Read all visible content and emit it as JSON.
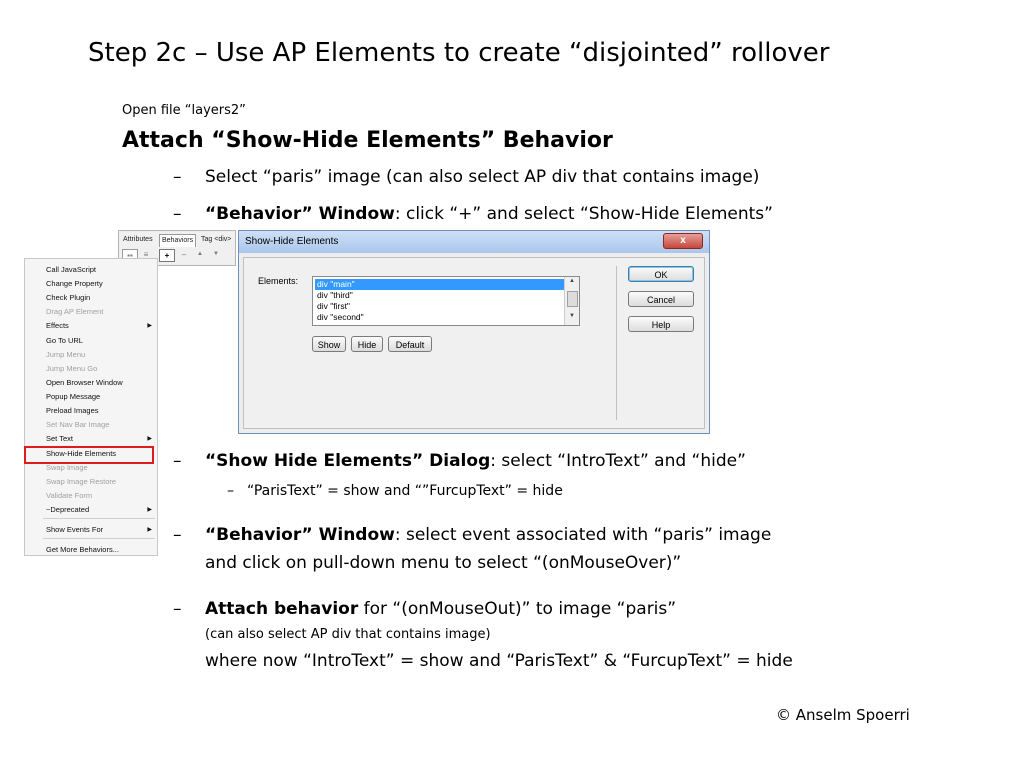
{
  "slide": {
    "title": "Step 2c – Use AP Elements to create “disjointed” rollover",
    "open_file": "Open file “layers2”",
    "heading": "Attach “Show-Hide Elements” Behavior",
    "dash": "–",
    "bullet1": "Select “paris” image (can also select AP div that contains image)",
    "bullet2_bold": "“Behavior” Window",
    "bullet2_rest": ": click “+” and select “Show-Hide Elements”",
    "bullet3_bold": "“Show Hide Elements” Dialog",
    "bullet3_rest": ": select “IntroText” and “hide”",
    "sub1": "“ParisText” = show and “”FurcupText” = hide",
    "bullet4_bold": "“Behavior” Window",
    "bullet4_rest": ": select event associated with “paris” image",
    "bullet4_line2": "and click on pull-down menu to select “(onMouseOver)”",
    "bullet5_bold": "Attach behavior",
    "bullet5_rest": " for “(onMouseOut)” to image “paris”",
    "bullet5_line2": "(can also select AP div that contains image)",
    "bullet5_line3": "where now “IntroText” = show and “ParisText” & “FurcupText” = hide",
    "credit": "© Anselm Spoerri"
  },
  "panel": {
    "tabs": [
      "Attributes",
      "Behaviors",
      "Tag <div>"
    ],
    "active_tab": "Behaviors",
    "plus_label": "+",
    "minus_label": "–",
    "up_label": "▲",
    "down_label": "▼"
  },
  "menu": {
    "items": [
      {
        "label": "Call JavaScript",
        "enabled": true,
        "submenu": false
      },
      {
        "label": "Change Property",
        "enabled": true,
        "submenu": false
      },
      {
        "label": "Check Plugin",
        "enabled": true,
        "submenu": false
      },
      {
        "label": "Drag AP Element",
        "enabled": false,
        "submenu": false
      },
      {
        "label": "Effects",
        "enabled": true,
        "submenu": true
      },
      {
        "label": "Go To URL",
        "enabled": true,
        "submenu": false
      },
      {
        "label": "Jump Menu",
        "enabled": false,
        "submenu": false
      },
      {
        "label": "Jump Menu Go",
        "enabled": false,
        "submenu": false
      },
      {
        "label": "Open Browser Window",
        "enabled": true,
        "submenu": false
      },
      {
        "label": "Popup Message",
        "enabled": true,
        "submenu": false
      },
      {
        "label": "Preload Images",
        "enabled": true,
        "submenu": false
      },
      {
        "label": "Set Nav Bar Image",
        "enabled": false,
        "submenu": false
      },
      {
        "label": "Set Text",
        "enabled": true,
        "submenu": true
      },
      {
        "label": "Show-Hide Elements",
        "enabled": true,
        "submenu": false,
        "highlighted": true
      },
      {
        "label": "Swap Image",
        "enabled": false,
        "submenu": false
      },
      {
        "label": "Swap Image Restore",
        "enabled": false,
        "submenu": false
      },
      {
        "label": "Validate Form",
        "enabled": false,
        "submenu": false
      },
      {
        "label": "~Deprecated",
        "enabled": true,
        "submenu": true
      },
      {
        "label": "Show Events For",
        "enabled": true,
        "submenu": true
      },
      {
        "label": "Get More Behaviors...",
        "enabled": true,
        "submenu": false
      }
    ],
    "submenu_arrow": "▶"
  },
  "dialog": {
    "title": "Show-Hide Elements",
    "close_label": "x",
    "elements_label": "Elements:",
    "elements": [
      "div \"main\"",
      "div \"third\"",
      "div \"first\"",
      "div \"second\""
    ],
    "selected_element": "div \"main\"",
    "show_button": "Show",
    "hide_button": "Hide",
    "default_button": "Default",
    "ok_button": "OK",
    "cancel_button": "Cancel",
    "help_button": "Help"
  },
  "colors": {
    "highlight_border": "#e01b1b",
    "selection": "#3399ff",
    "titlebar": "#a9c6ec",
    "close_button": "#c5473b"
  }
}
